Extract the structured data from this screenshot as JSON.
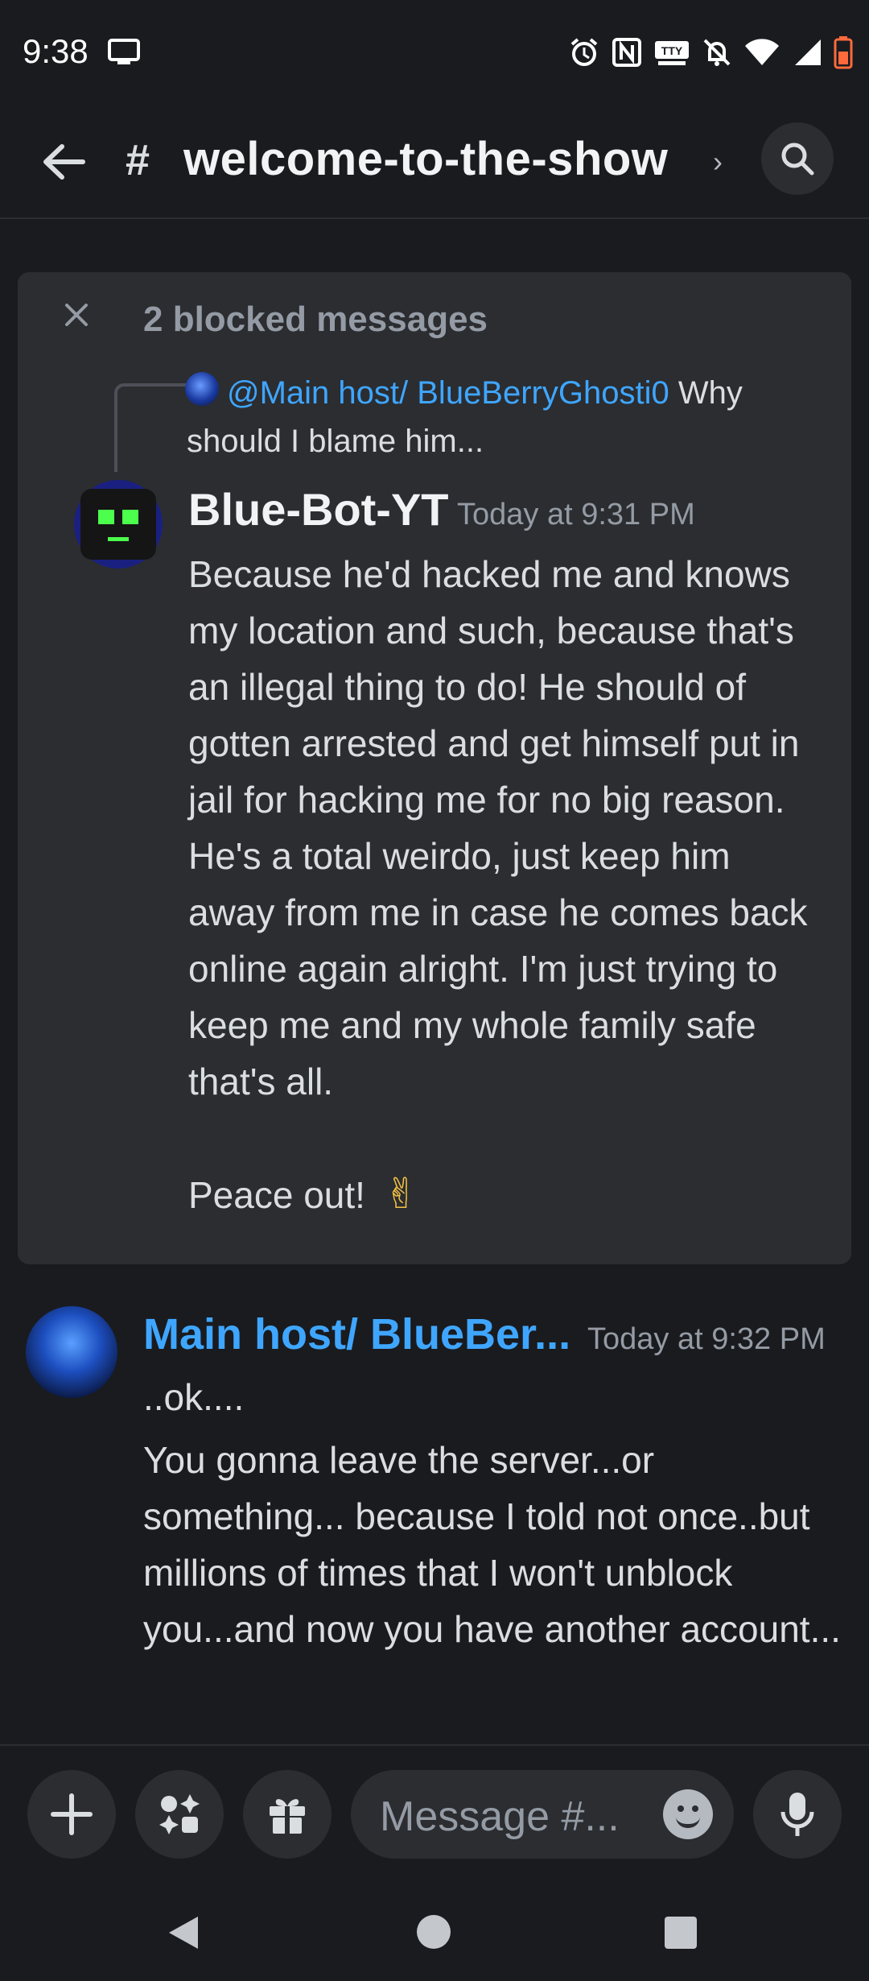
{
  "status_bar": {
    "time": "9:38"
  },
  "header": {
    "hash": "#",
    "channel_name": "welcome-to-the-show",
    "chevron": "›"
  },
  "blocked": {
    "title": "2 blocked messages",
    "reply": {
      "mention": "@Main host/ BlueBerryGhosti0",
      "text": " Why should I blame him..."
    },
    "message": {
      "author": "Blue-Bot-YT",
      "timestamp": "Today at 9:31 PM",
      "body": "Because he'd hacked me and knows my location and such, because that's an illegal thing to do! He should of gotten arrested and get himself put in jail for hacking me for no big reason. He's a total weirdo, just keep him away from me in case he comes back online again alright. I'm just trying to keep me and my whole family safe that's all.",
      "body2": "Peace out!",
      "emoji": "✌"
    }
  },
  "message2": {
    "author": "Main host/ BlueBer...",
    "timestamp": "Today at 9:32 PM",
    "line1": "..ok....",
    "body": "You gonna leave the server...or something... because I told not once..but millions of times that I won't unblock you...and now you have another account..."
  },
  "input_bar": {
    "placeholder": "Message #..."
  },
  "icons": [
    "cast-icon",
    "alarm-icon",
    "nfc-icon",
    "tty-icon",
    "bell-off-icon",
    "wifi-icon",
    "signal-icon",
    "battery-icon",
    "back-arrow-icon",
    "search-icon",
    "close-icon",
    "plus-icon",
    "apps-icon",
    "gift-icon",
    "emoji-icon",
    "mic-icon"
  ],
  "colors": {
    "background": "#1a1b1f",
    "card": "#2b2d31",
    "link": "#3fa6ff",
    "muted": "#949ba4"
  }
}
